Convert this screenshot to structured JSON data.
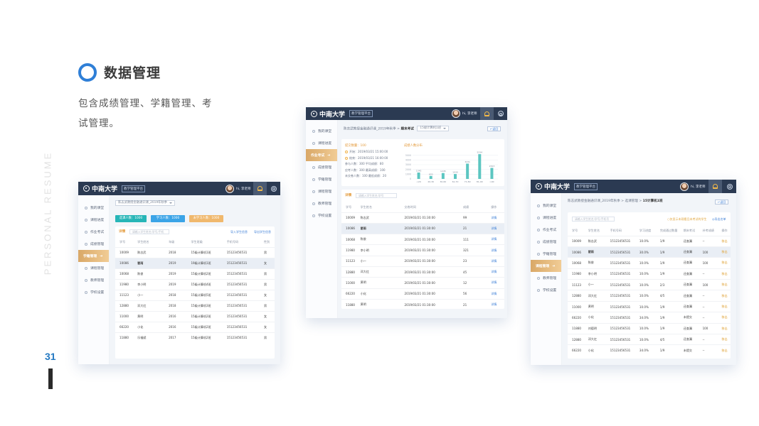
{
  "page": {
    "side_text": "PERSONAL RESUME",
    "page_number": "31",
    "section_title": "数据管理",
    "section_desc": "包含成绩管理、学籍管理、考试管理。"
  },
  "app": {
    "logo": "中南大学",
    "tag": "教学管理平台",
    "user": "hi, 李老师",
    "back": "返回"
  },
  "win1": {
    "nav": [
      "我的课堂",
      "课程进度",
      "作业考试",
      "成绩管理",
      "学籍管理",
      "课程管理",
      "教师管理",
      "学校设置"
    ],
    "active": "学籍管理",
    "select": "陈志武教授金融通识课_2019年秋季",
    "buttons": [
      "选课人数：1000",
      "学习人数：1000",
      "未学习人数：1000"
    ],
    "detail_label": "详情",
    "search_placeholder": "请输入学生姓名/学号/手机",
    "import_link": "导入学生信息",
    "export_link": "导出学生信息",
    "columns": [
      "学号",
      "学生姓名",
      "年级",
      "学生班级",
      "手机号码",
      "性别"
    ],
    "rows": [
      [
        "10009",
        "陈志武",
        "2018",
        "15级计算机1班",
        "15123456531",
        "男"
      ],
      [
        "10086",
        "翟雨",
        "2019",
        "19级计算机1班",
        "15123456531",
        "女"
      ],
      [
        "10068",
        "陈俊",
        "2019",
        "15级计算机2班",
        "15123456531",
        "男"
      ],
      [
        "11980",
        "李小明",
        "2019",
        "15级计算机4班",
        "15123456531",
        "男"
      ],
      [
        "11123",
        "小一",
        "2018",
        "15级计算机5班",
        "15123456531",
        "女"
      ],
      [
        "12880",
        "邓大红",
        "2018",
        "15级计算机3班",
        "15123456531",
        "男"
      ],
      [
        "11000",
        "黄明",
        "2016",
        "15级计算机2班",
        "15123456531",
        "女"
      ],
      [
        "66220",
        "小化",
        "2016",
        "15级计算机2班",
        "15123456531",
        "女"
      ],
      [
        "11880",
        "乐福斌",
        "2017",
        "15级计算机2班",
        "15123456531",
        "男"
      ]
    ]
  },
  "win2": {
    "nav": [
      "我的课堂",
      "课程进度",
      "作业考试",
      "成绩管理",
      "学籍管理",
      "课程管理",
      "教师管理",
      "学校设置"
    ],
    "active": "作业考试",
    "breadcrumb_prefix": "陈志武教授金融通识课_2019年秋季",
    "breadcrumb_current": "期末考试",
    "select": "15级计算机1班",
    "stats_title": "提交数量：100",
    "stats_lines": [
      "开始：2019/03/21  15:00:00",
      "结束：2019/03/21  16:00:00",
      "参与人数：300    平均成绩：80",
      "应考人数：300    最高成绩：100",
      "未交卷人数：100    最低成绩：20"
    ],
    "chart_title": "成绩人数分布",
    "detail_label": "详情",
    "search_placeholder": "请输入学生姓名/学号",
    "columns": [
      "学号",
      "学生姓名",
      "交卷时间",
      "成绩",
      "操作"
    ],
    "rows": [
      [
        "10009",
        "陈志武",
        "2019/03/21  01:30:00",
        "99",
        "详情"
      ],
      [
        "10086",
        "翟雨",
        "2019/03/21  01:30:00",
        "21",
        "详情"
      ],
      [
        "10068",
        "陈俊",
        "2019/03/21  01:30:00",
        "111",
        "详情"
      ],
      [
        "11980",
        "李小明",
        "2019/03/21  01:30:00",
        "321",
        "详情"
      ],
      [
        "11123",
        "小一",
        "2019/03/21  01:30:00",
        "23",
        "详情"
      ],
      [
        "12880",
        "邓大红",
        "2019/03/21  01:30:00",
        "45",
        "详情"
      ],
      [
        "11000",
        "黄明",
        "2019/03/21  01:30:00",
        "12",
        "详情"
      ],
      [
        "66220",
        "小化",
        "2019/03/21  01:30:00",
        "56",
        "详情"
      ],
      [
        "11880",
        "黄明",
        "2019/03/21  01:30:00",
        "21",
        "详情"
      ]
    ]
  },
  "chart_data": {
    "type": "bar",
    "title": "成绩人数分布",
    "categories": [
      "<20",
      "20-30",
      "30-60",
      "61-70",
      "71-80",
      "81-90",
      ">90"
    ],
    "values": [
      1345,
      620,
      1245,
      1030,
      3231,
      5234,
      2323
    ],
    "ylim": [
      0,
      6000
    ],
    "yticks": [
      0,
      1000,
      2000,
      3000,
      4000,
      5000
    ]
  },
  "win3": {
    "nav": [
      "我的课堂",
      "课程进度",
      "作业考试",
      "成绩管理",
      "学籍管理",
      "课程管理",
      "教师管理",
      "学校设置"
    ],
    "active": "课程管理",
    "breadcrumb_prefix": "陈志武教授金融通识课_2019年秋季 > 选课管理 > ",
    "breadcrumb_current": "15计算机1班",
    "search_placeholder": "请输入学生姓名/学号/手机号",
    "warn_link": "仅显示未观看且未考试的学生",
    "export_link": "导出名单",
    "columns": [
      "学号",
      "学生姓名",
      "手机号码",
      "学习进度",
      "完成通过数量",
      "期末考试",
      "补考成绩",
      "操作"
    ],
    "rows": [
      [
        "10009",
        "陈志武",
        "15123456531",
        "10.0%",
        "1/9",
        "还查漏",
        "--",
        "移出"
      ],
      [
        "10086",
        "翟雨",
        "15123456531",
        "30.0%",
        "1/9",
        "还查漏",
        "100",
        "移出"
      ],
      [
        "10068",
        "陈俊",
        "15123456531",
        "10.0%",
        "1/9",
        "还查漏",
        "100",
        "移出"
      ],
      [
        "11980",
        "李小明",
        "15123456531",
        "10.0%",
        "1/9",
        "还查漏",
        "--",
        "移出"
      ],
      [
        "11123",
        "小一",
        "15123456531",
        "10.0%",
        "2/3",
        "还查漏",
        "100",
        "移出"
      ],
      [
        "12880",
        "邓大红",
        "15123456531",
        "10.0%",
        "4/5",
        "还查漏",
        "--",
        "移出"
      ],
      [
        "11000",
        "黄明",
        "15123456531",
        "10.0%",
        "1/9",
        "还查漏",
        "--",
        "移出"
      ],
      [
        "66220",
        "小化",
        "15123456531",
        "34.0%",
        "1/9",
        "未提交",
        "--",
        "移出"
      ],
      [
        "11880",
        "刘德明",
        "15123456531",
        "10.0%",
        "1/9",
        "还查漏",
        "100",
        "移出"
      ],
      [
        "12880",
        "邓大红",
        "15123456531",
        "10.0%",
        "4/5",
        "还查漏",
        "--",
        "移出"
      ],
      [
        "66220",
        "小化",
        "15123456531",
        "34.0%",
        "1/9",
        "未提交",
        "--",
        "移出"
      ]
    ]
  }
}
